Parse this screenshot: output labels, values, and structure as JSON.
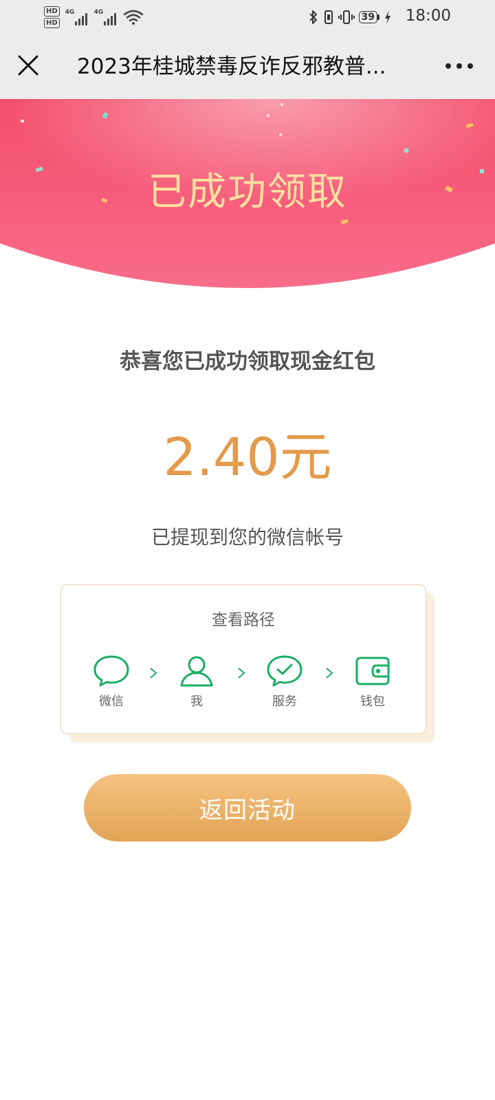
{
  "status_bar": {
    "hd1": "HD",
    "hd2": "HD",
    "net1": "4G",
    "net2": "4G",
    "battery": "39",
    "time": "18:00"
  },
  "nav": {
    "title": "2023年桂城禁毒反诈反邪教普...",
    "close_icon": "close-icon",
    "more_icon": "more-icon"
  },
  "banner": {
    "title": "已成功领取"
  },
  "result": {
    "headline": "恭喜您已成功领取现金红包",
    "amount": "2.40元",
    "subtext": "已提现到您的微信帐号"
  },
  "path_card": {
    "title": "查看路径",
    "steps": [
      {
        "label": "微信",
        "icon": "chat-bubble-icon"
      },
      {
        "label": "我",
        "icon": "person-icon"
      },
      {
        "label": "服务",
        "icon": "check-chat-icon"
      },
      {
        "label": "钱包",
        "icon": "wallet-icon"
      }
    ]
  },
  "button": {
    "label": "返回活动"
  },
  "colors": {
    "banner_pink": "#f1576f",
    "gold_text": "#fbe0a0",
    "amount_orange": "#e49a4a",
    "icon_green": "#1aad63",
    "button_gold": "#eab36e"
  }
}
